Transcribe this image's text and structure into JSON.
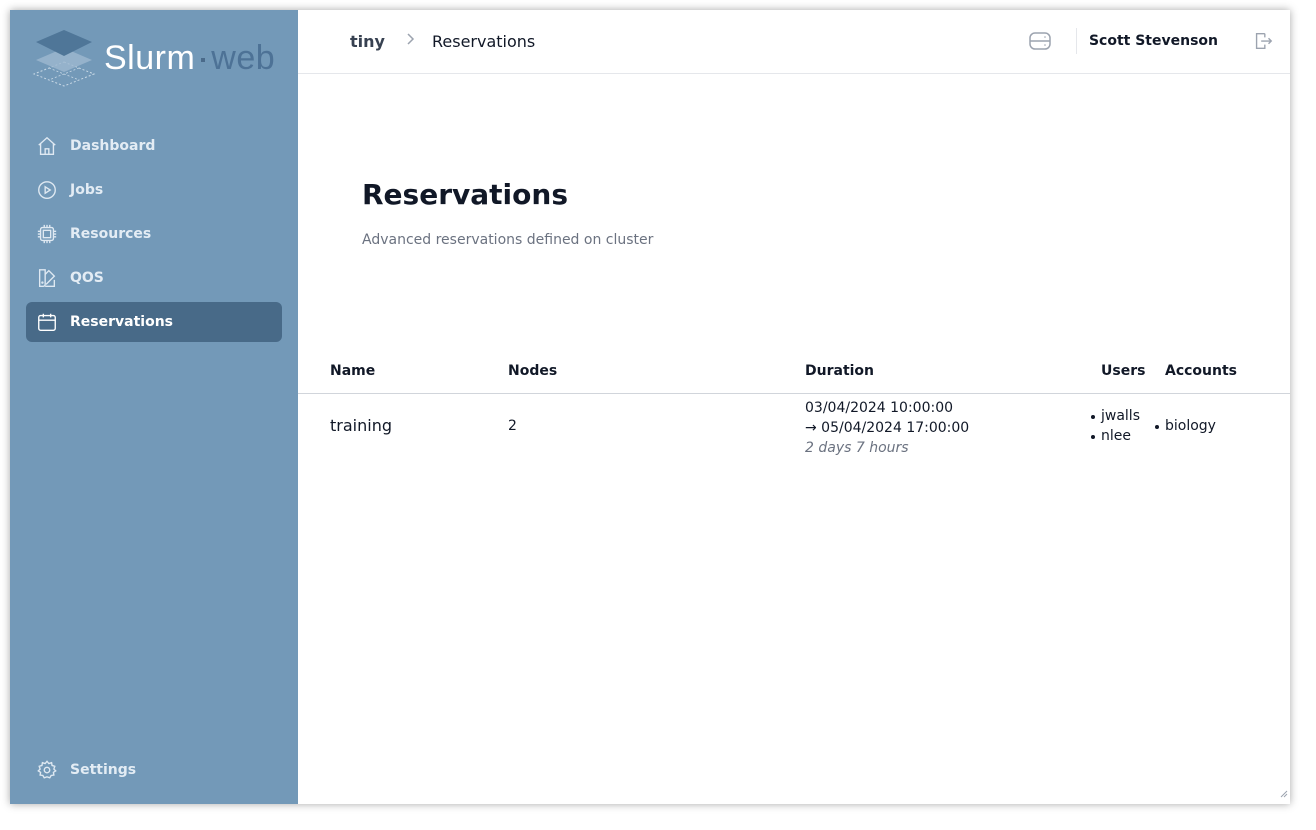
{
  "app": {
    "logo_primary": "Slurm",
    "logo_secondary": "web"
  },
  "sidebar": {
    "items": [
      {
        "label": "Dashboard",
        "icon": "home-icon",
        "active": false
      },
      {
        "label": "Jobs",
        "icon": "play-circle-icon",
        "active": false
      },
      {
        "label": "Resources",
        "icon": "cpu-chip-icon",
        "active": false
      },
      {
        "label": "QOS",
        "icon": "swatch-icon",
        "active": false
      },
      {
        "label": "Reservations",
        "icon": "calendar-icon",
        "active": true
      }
    ],
    "settings_label": "Settings"
  },
  "topbar": {
    "cluster": "tiny",
    "separator": ">",
    "current_page": "Reservations",
    "username": "Scott Stevenson"
  },
  "page": {
    "title": "Reservations",
    "subtitle": "Advanced reservations defined on cluster"
  },
  "table": {
    "headers": {
      "name": "Name",
      "nodes": "Nodes",
      "duration": "Duration",
      "users": "Users",
      "accounts": "Accounts"
    },
    "rows": [
      {
        "name": "training",
        "nodes": "2",
        "start": "03/04/2024 10:00:00",
        "end": "→ 05/04/2024 17:00:00",
        "span": "2 days 7 hours",
        "users": [
          "jwalls",
          "nlee"
        ],
        "accounts": [
          "biology"
        ]
      }
    ]
  },
  "colors": {
    "sidebar_bg": "#7399b8",
    "sidebar_active_bg": "#486a88",
    "text_primary": "#111827",
    "text_muted": "#6b7280"
  }
}
